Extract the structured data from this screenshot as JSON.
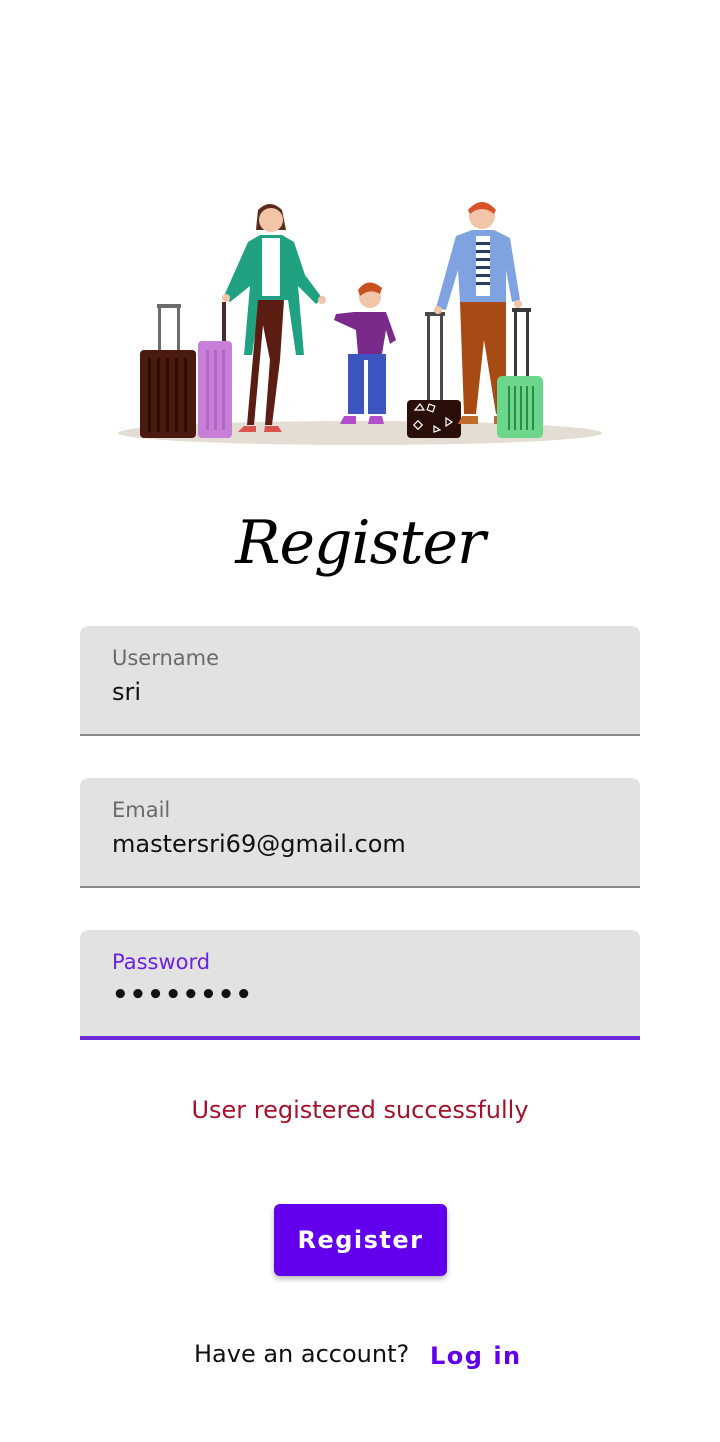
{
  "screen": {
    "title": "Register",
    "hero_image": "family-travel-illustration"
  },
  "form": {
    "username": {
      "label": "Username",
      "value": "sri"
    },
    "email": {
      "label": "Email",
      "value": "mastersri69@gmail.com"
    },
    "password": {
      "label": "Password",
      "value": "••••••••"
    }
  },
  "status_message": "User registered successfully",
  "register_button": {
    "label": "Register"
  },
  "footer": {
    "prompt": "Have an account?",
    "login_link": "Log in"
  },
  "colors": {
    "primary": "#6200ee",
    "active_field": "#6b21e0",
    "message": "#a3122a",
    "field_bg": "#e2e2e2"
  }
}
